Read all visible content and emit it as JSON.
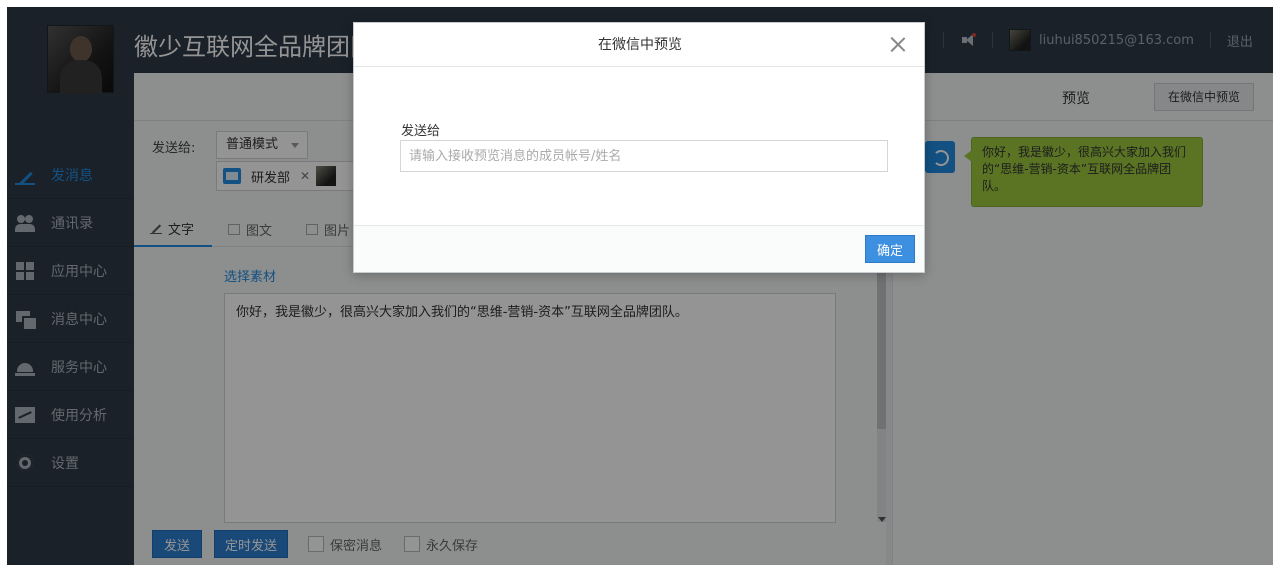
{
  "header": {
    "org_title": "徽少互联网全品牌团队",
    "user_email": "liuhui850215@163.com",
    "logout_label": "退出"
  },
  "sidebar": {
    "items": [
      {
        "label": "发消息",
        "icon": "pen-icon",
        "active": true
      },
      {
        "label": "通讯录",
        "icon": "users-icon",
        "active": false
      },
      {
        "label": "应用中心",
        "icon": "apps-icon",
        "active": false
      },
      {
        "label": "消息中心",
        "icon": "message-icon",
        "active": false
      },
      {
        "label": "服务中心",
        "icon": "service-bell-icon",
        "active": false
      },
      {
        "label": "使用分析",
        "icon": "chart-icon",
        "active": false
      },
      {
        "label": "设置",
        "icon": "gear-icon",
        "active": false
      }
    ]
  },
  "editor": {
    "send_to_label": "发送给:",
    "mode_value": "普通模式",
    "recipient_tag": "研发部",
    "tabs": [
      {
        "label": "文字",
        "active": true
      },
      {
        "label": "图文",
        "active": false
      },
      {
        "label": "图片",
        "active": false
      }
    ],
    "choose_material": "选择素材",
    "message_text": "你好，我是徽少，很高兴大家加入我们的“思维-营销-资本”互联网全品牌团队。",
    "send_label": "发送",
    "schedule_label": "定时发送",
    "secret_label": "保密消息",
    "permanent_label": "永久保存"
  },
  "preview": {
    "label": "预览",
    "wechat_button": "在微信中预览",
    "bubble_text": "你好，我是徽少，很高兴大家加入我们的“思维-营销-资本”互联网全品牌团队。"
  },
  "modal": {
    "title": "在微信中预览",
    "field_label": "发送给",
    "input_placeholder": "请输入接收预览消息的成员帐号/姓名",
    "input_value": "",
    "confirm_label": "确定"
  },
  "colors": {
    "accent": "#1f8ce0",
    "sidebar_bg": "#2d3a48",
    "bubble_green": "#9bc83f"
  }
}
